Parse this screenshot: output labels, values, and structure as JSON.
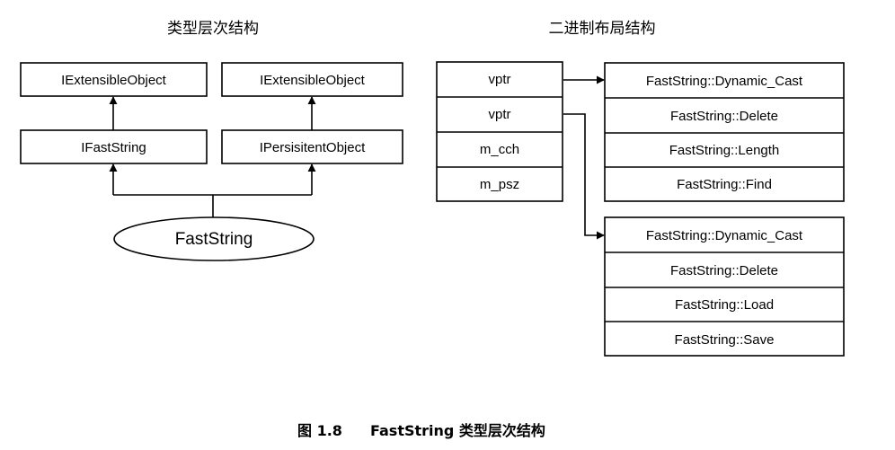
{
  "left_title": "类型层次结构",
  "right_title": "二进制布局结构",
  "hierarchy": {
    "left_top": "IExtensibleObject",
    "left_mid": "IFastString",
    "right_top": "IExtensibleObject",
    "right_mid": "IPersisitentObject",
    "class_name": "FastString"
  },
  "object_layout": [
    "vptr",
    "vptr",
    "m_cch",
    "m_psz"
  ],
  "vtable_1": [
    "FastString::Dynamic_Cast",
    "FastString::Delete",
    "FastString::Length",
    "FastString::Find"
  ],
  "vtable_2": [
    "FastString::Dynamic_Cast",
    "FastString::Delete",
    "FastString::Load",
    "FastString::Save"
  ],
  "caption": {
    "label": "图 1.8",
    "text": "FastString 类型层次结构"
  }
}
